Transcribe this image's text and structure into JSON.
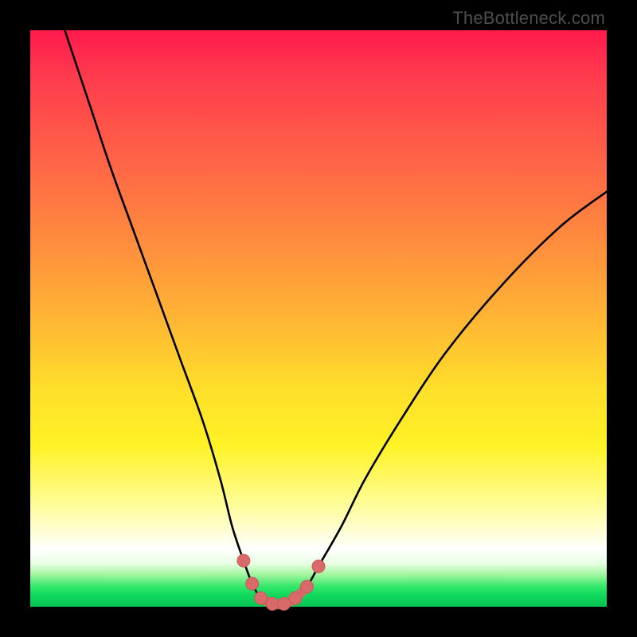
{
  "attribution": "TheBottleneck.com",
  "colors": {
    "frame": "#000000",
    "curve": "#000000",
    "marker_fill": "#d96a6a",
    "marker_stroke": "#c95b5b",
    "gradient_stops": [
      "#ff1a4d",
      "#ff3b4e",
      "#ff6247",
      "#ff8a3e",
      "#ffb534",
      "#ffde2a",
      "#fff225",
      "#fffb7e",
      "#fffec8",
      "#ffffff",
      "#e8ffe3",
      "#9ff59d",
      "#33e86a",
      "#0fd85c",
      "#07c552"
    ]
  },
  "chart_data": {
    "type": "line",
    "title": "",
    "xlabel": "",
    "ylabel": "",
    "xlim": [
      0,
      100
    ],
    "ylim": [
      0,
      100
    ],
    "grid": false,
    "series": [
      {
        "name": "bottleneck-curve",
        "x": [
          6,
          10,
          14,
          18,
          22,
          26,
          30,
          33,
          35,
          37,
          38.5,
          40,
          42,
          44,
          46,
          48,
          50,
          54,
          58,
          64,
          72,
          82,
          92,
          100
        ],
        "y": [
          100,
          88,
          76,
          65,
          54,
          43,
          32,
          22,
          14,
          8,
          4,
          1.5,
          0.5,
          0.5,
          1.5,
          3.5,
          7,
          14,
          22,
          32,
          44,
          56,
          66,
          72
        ]
      }
    ],
    "markers": [
      {
        "x": 37.0,
        "y": 8.0
      },
      {
        "x": 38.5,
        "y": 4.0
      },
      {
        "x": 40.0,
        "y": 1.5
      },
      {
        "x": 42.0,
        "y": 0.5
      },
      {
        "x": 44.0,
        "y": 0.5
      },
      {
        "x": 46.0,
        "y": 1.5
      },
      {
        "x": 48.0,
        "y": 3.5
      },
      {
        "x": 50.0,
        "y": 7.0
      }
    ],
    "flat_bottom_segment": {
      "x": [
        40,
        42,
        44,
        46,
        48
      ],
      "y": [
        1.5,
        0.5,
        0.5,
        1.5,
        3.5
      ]
    }
  }
}
